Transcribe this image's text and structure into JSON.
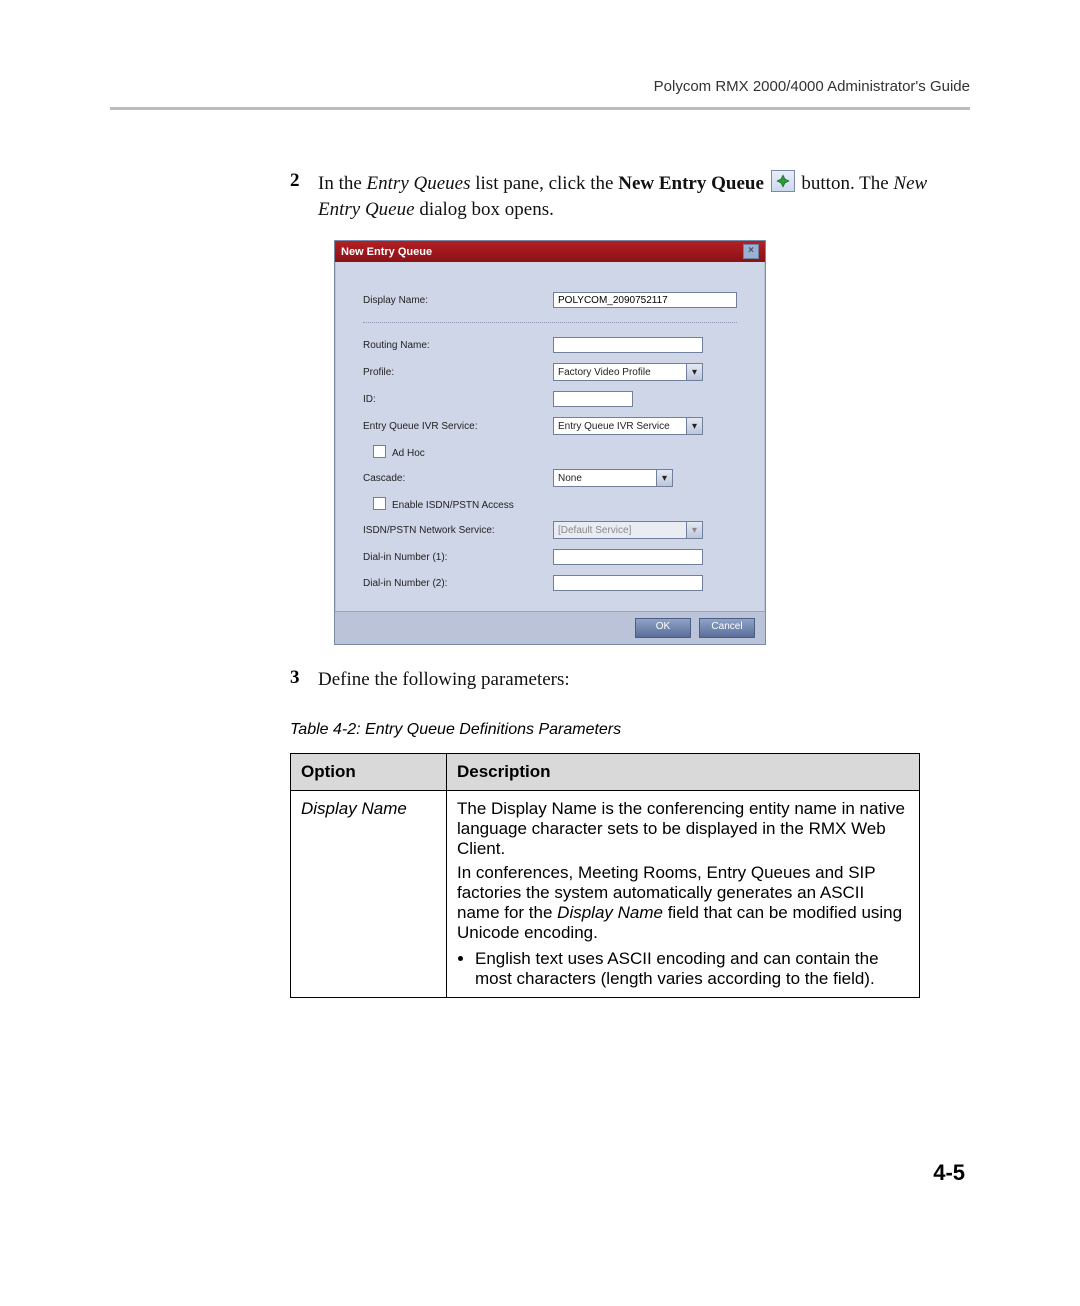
{
  "header": {
    "title": "Polycom RMX 2000/4000 Administrator's Guide"
  },
  "step2": {
    "num": "2",
    "text_a": "In the ",
    "text_b": "Entry Queues",
    "text_c": " list pane, click the ",
    "text_d": "New Entry Queue",
    "text_e": " button. The ",
    "text_f": "New Entry Queue",
    "text_g": " dialog box opens."
  },
  "dialog": {
    "title": "New Entry Queue",
    "labels": {
      "display_name": "Display Name:",
      "routing_name": "Routing Name:",
      "profile": "Profile:",
      "id": "ID:",
      "ivr": "Entry Queue IVR Service:",
      "adhoc": "Ad Hoc",
      "cascade": "Cascade:",
      "enable_isdn": "Enable ISDN/PSTN Access",
      "isdn_service": "ISDN/PSTN Network Service:",
      "dial1": "Dial-in Number (1):",
      "dial2": "Dial-in Number (2):"
    },
    "values": {
      "display_name": "POLYCOM_2090752117",
      "profile": "Factory Video Profile",
      "ivr": "Entry Queue IVR Service",
      "cascade": "None",
      "isdn_service": "[Default Service]"
    },
    "buttons": {
      "ok": "OK",
      "cancel": "Cancel"
    }
  },
  "step3": {
    "num": "3",
    "text": "Define the following parameters:"
  },
  "table": {
    "caption": "Table 4-2: Entry Queue Definitions Parameters",
    "head": {
      "option": "Option",
      "desc": "Description"
    },
    "row1": {
      "option": "Display Name",
      "p1": "The Display Name is the conferencing entity name in native language character sets to be displayed in the RMX Web Client.",
      "p2a": "In conferences, Meeting Rooms, Entry Queues and SIP factories the system automatically generates an ASCII name for the ",
      "p2b": "Display Name",
      "p2c": " field that can be modified using Unicode encoding.",
      "bullet1": "English text uses ASCII encoding and can contain the most characters (length varies according to the field)."
    }
  },
  "page_num": "4-5"
}
